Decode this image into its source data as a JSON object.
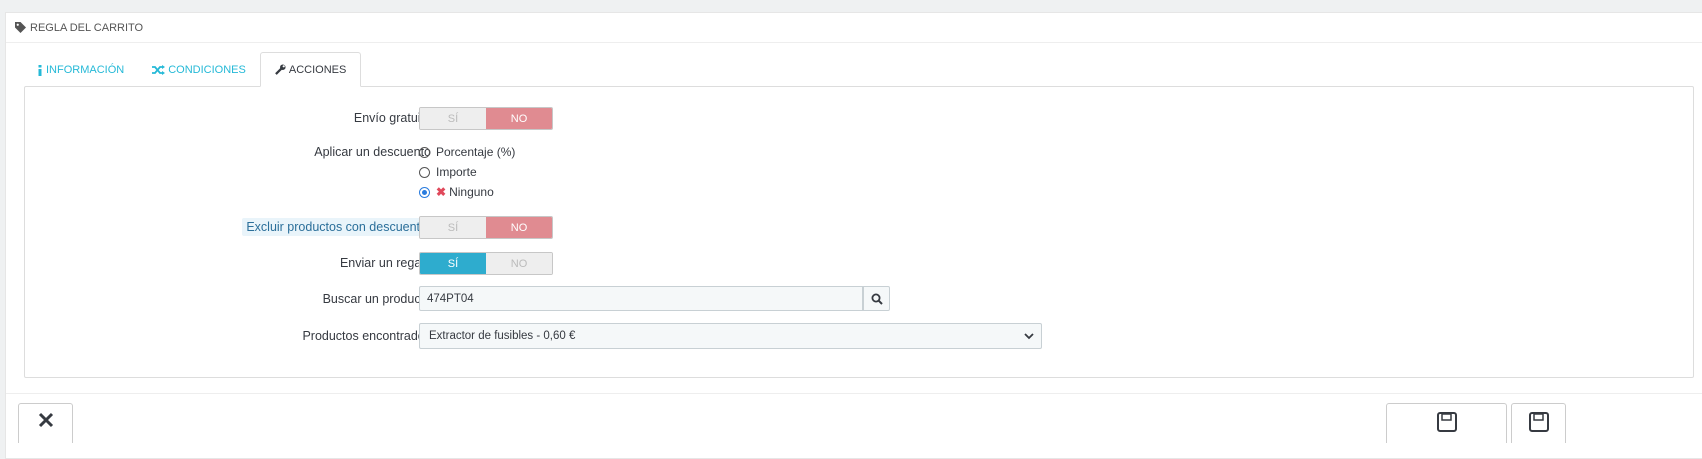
{
  "panel": {
    "title": "REGLA DEL CARRITO",
    "icon": "tag-icon"
  },
  "tabs": [
    {
      "label": "INFORMACIÓN",
      "icon": "info-icon",
      "active": false
    },
    {
      "label": "CONDICIONES",
      "icon": "random-icon",
      "active": false
    },
    {
      "label": "ACCIONES",
      "icon": "wrench-icon",
      "active": true
    }
  ],
  "form": {
    "free_shipping": {
      "label": "Envío gratuito",
      "yes": "SÍ",
      "no": "NO",
      "value": "NO"
    },
    "discount": {
      "label": "Aplicar un descuento",
      "options": [
        "Porcentaje (%)",
        "Importe",
        "Ninguno"
      ],
      "selected": "Ninguno"
    },
    "exclude": {
      "label": "Excluir productos con descuento",
      "yes": "SÍ",
      "no": "NO",
      "value": "NO"
    },
    "gift": {
      "label": "Enviar un regalo",
      "yes": "SÍ",
      "no": "NO",
      "value": "SÍ"
    },
    "search": {
      "label": "Buscar un producto",
      "value": "474PT04"
    },
    "found": {
      "label": "Productos encontrados",
      "selected": "Extractor de fusibles - 0,60 €"
    }
  },
  "colors": {
    "accent": "#25b9d7",
    "no_active": "#e08b91",
    "yes_active": "#2eacce"
  }
}
